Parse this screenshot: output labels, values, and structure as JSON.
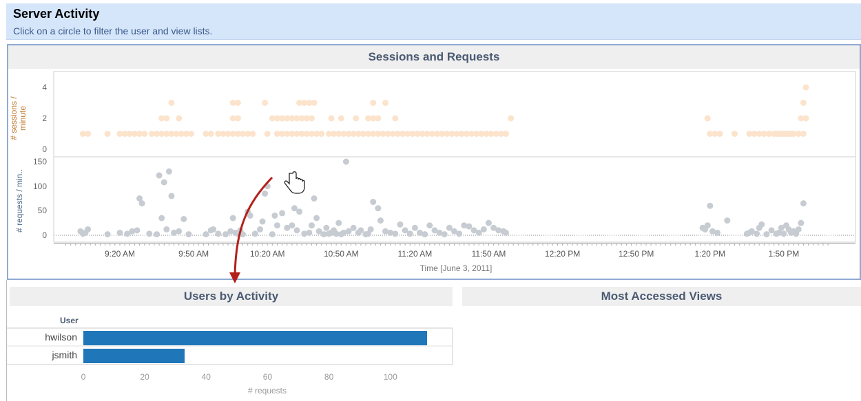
{
  "header": {
    "title": "Server Activity",
    "subtitle": "Click on a circle to filter the user and view lists."
  },
  "sessions_panel": {
    "title": "Sessions and Requests",
    "sessions_ylabel_line1": "# sessions /",
    "sessions_ylabel_line2": "minute",
    "requests_ylabel": "# requests / min..",
    "x_axis_title": "Time [June 3, 2011]"
  },
  "users_panel": {
    "title": "Users by Activity",
    "column_header": "User",
    "x_axis_title": "# requests"
  },
  "views_panel": {
    "title": "Most Accessed Views"
  },
  "colors": {
    "header_bg": "#d5e6fb",
    "sessions_dots": "#fbe3cc",
    "requests_dots": "#c7ccd2",
    "bar": "#1f76b8",
    "selected_dot": "#1a6396",
    "arrow": "#b3201c",
    "sessions_label": "#c07a30",
    "requests_label": "#4d6a8a"
  },
  "chart_data": [
    {
      "type": "scatter",
      "name": "sessions",
      "ylabel": "# sessions / minute",
      "ylim": [
        0,
        4.5
      ],
      "yticks": [
        0,
        2,
        4
      ],
      "x": [
        "9:05",
        "9:07",
        "9:15",
        "9:20",
        "9:22",
        "9:24",
        "9:26",
        "9:28",
        "9:30",
        "9:33",
        "9:35",
        "9:37",
        "9:39",
        "9:41",
        "9:43",
        "9:45",
        "9:47",
        "9:49",
        "9:55",
        "9:57",
        "10:00",
        "10:02",
        "10:04",
        "10:06",
        "10:08",
        "10:10",
        "10:12",
        "10:14",
        "10:20",
        "10:24",
        "10:26",
        "10:28",
        "10:30",
        "10:32",
        "10:34",
        "10:36",
        "10:38",
        "10:40",
        "10:42",
        "10:45",
        "10:47",
        "10:49",
        "10:51",
        "10:53",
        "10:55",
        "10:57",
        "10:59",
        "11:01",
        "11:03",
        "11:05",
        "11:07",
        "11:09",
        "11:11",
        "11:13",
        "11:15",
        "11:17",
        "11:19",
        "11:21",
        "11:23",
        "11:25",
        "11:27",
        "11:29",
        "11:31",
        "11:33",
        "11:35",
        "11:37",
        "11:39",
        "11:41",
        "11:43",
        "11:45",
        "11:47",
        "11:49",
        "11:51",
        "11:53",
        "11:55",
        "11:57",
        "1:20",
        "1:22",
        "1:24",
        "1:30",
        "1:36",
        "1:38",
        "1:40",
        "1:42",
        "1:44",
        "1:46",
        "1:48",
        "1:50",
        "1:52",
        "1:54",
        "1:56",
        "1:58",
        "1:42",
        "1:47",
        "1:49",
        "1:51",
        "1:53",
        "10:06",
        "10:08",
        "10:28",
        "10:30",
        "9:37",
        "9:39",
        "9:44",
        "10:22",
        "10:24",
        "10:26",
        "10:28",
        "10:30",
        "10:32",
        "10:34",
        "10:36",
        "10:38",
        "10:46",
        "10:50",
        "10:56",
        "11:01",
        "11:03",
        "11:05",
        "11:12",
        "11:59",
        "1:19",
        "1:57",
        "1:59",
        "9:41",
        "10:06",
        "10:08",
        "10:19",
        "10:33",
        "10:35",
        "10:37",
        "10:39",
        "11:03",
        "11:08",
        "1:58",
        "1:59"
      ],
      "y": [
        1,
        1,
        1,
        1,
        1,
        1,
        1,
        1,
        1,
        1,
        1,
        1,
        1,
        1,
        1,
        1,
        1,
        1,
        1,
        1,
        1,
        1,
        1,
        1,
        1,
        1,
        1,
        1,
        1,
        1,
        1,
        1,
        1,
        1,
        1,
        1,
        1,
        1,
        1,
        1,
        1,
        1,
        1,
        1,
        1,
        1,
        1,
        1,
        1,
        1,
        1,
        1,
        1,
        1,
        1,
        1,
        1,
        1,
        1,
        1,
        1,
        1,
        1,
        1,
        1,
        1,
        1,
        1,
        1,
        1,
        1,
        1,
        1,
        1,
        1,
        1,
        1,
        1,
        1,
        1,
        1,
        1,
        1,
        1,
        1,
        1,
        1,
        1,
        1,
        1,
        1,
        1,
        1,
        1,
        1,
        1,
        1,
        2,
        2,
        2,
        2,
        2,
        2,
        2,
        2,
        2,
        2,
        2,
        2,
        2,
        2,
        2,
        2,
        2,
        2,
        2,
        2,
        2,
        2,
        2,
        2,
        2,
        2,
        2,
        3,
        3,
        3,
        3,
        3,
        3,
        3,
        3,
        3,
        3,
        3,
        4
      ]
    },
    {
      "type": "scatter",
      "name": "requests",
      "ylabel": "# requests / min..",
      "xlabel": "Time [June 3, 2011]",
      "ylim": [
        -5,
        160
      ],
      "yticks": [
        0,
        50,
        100,
        150
      ],
      "xticks": [
        "9:20 AM",
        "9:50 AM",
        "10:20 AM",
        "10:50 AM",
        "11:20 AM",
        "11:50 AM",
        "12:20 PM",
        "12:50 PM",
        "1:20 PM",
        "1:50 PM"
      ],
      "x": [
        "9:04",
        "9:05",
        "9:06",
        "9:07",
        "9:15",
        "9:20",
        "9:23",
        "9:25",
        "9:27",
        "9:28",
        "9:29",
        "9:32",
        "9:35",
        "9:36",
        "9:37",
        "9:38",
        "9:39",
        "9:40",
        "9:41",
        "9:42",
        "9:44",
        "9:46",
        "9:48",
        "9:55",
        "9:57",
        "9:58",
        "10:00",
        "10:03",
        "10:05",
        "10:06",
        "10:07",
        "10:08",
        "10:09",
        "10:10",
        "10:12",
        "10:13",
        "10:15",
        "10:17",
        "10:18",
        "10:19",
        "10:20",
        "10:22",
        "10:24",
        "10:26",
        "10:28",
        "10:30",
        "10:31",
        "10:32",
        "10:33",
        "10:35",
        "10:37",
        "10:38",
        "10:39",
        "10:40",
        "10:41",
        "10:43",
        "10:44",
        "10:45",
        "10:46",
        "10:47",
        "10:48",
        "10:49",
        "10:50",
        "10:51",
        "10:52",
        "10:53",
        "10:55",
        "10:57",
        "10:58",
        "11:00",
        "11:01",
        "11:02",
        "11:03",
        "11:05",
        "11:06",
        "11:08",
        "11:10",
        "11:12",
        "11:14",
        "11:16",
        "11:18",
        "11:20",
        "11:22",
        "11:24",
        "11:26",
        "11:28",
        "11:30",
        "11:32",
        "11:34",
        "11:36",
        "11:38",
        "11:40",
        "11:42",
        "11:44",
        "11:46",
        "11:48",
        "11:50",
        "11:52",
        "11:54",
        "11:56",
        "11:57",
        "1:17",
        "1:18",
        "1:19",
        "1:20",
        "1:21",
        "1:23",
        "1:27",
        "1:35",
        "1:36",
        "1:37",
        "1:39",
        "1:40",
        "1:41",
        "1:43",
        "1:45",
        "1:47",
        "1:48",
        "1:49",
        "1:50",
        "1:51",
        "1:52",
        "1:53",
        "1:54",
        "1:55",
        "1:56",
        "1:57",
        "1:58",
        "10:23"
      ],
      "y": [
        8,
        3,
        5,
        12,
        2,
        5,
        3,
        8,
        10,
        75,
        65,
        3,
        2,
        122,
        35,
        108,
        12,
        130,
        80,
        5,
        8,
        33,
        2,
        2,
        10,
        12,
        3,
        2,
        8,
        35,
        5,
        3,
        10,
        2,
        48,
        40,
        3,
        12,
        28,
        85,
        100,
        2,
        20,
        45,
        15,
        20,
        55,
        10,
        48,
        3,
        5,
        20,
        75,
        35,
        8,
        2,
        15,
        3,
        5,
        10,
        3,
        25,
        2,
        5,
        150,
        8,
        15,
        5,
        10,
        2,
        3,
        12,
        68,
        55,
        30,
        8,
        5,
        3,
        22,
        10,
        3,
        15,
        5,
        2,
        20,
        10,
        5,
        2,
        15,
        8,
        3,
        20,
        18,
        10,
        5,
        12,
        25,
        15,
        10,
        8,
        5,
        15,
        12,
        20,
        60,
        8,
        5,
        30,
        3,
        5,
        8,
        3,
        15,
        22,
        2,
        10,
        3,
        5,
        15,
        3,
        20,
        12,
        5,
        8,
        3,
        12,
        25,
        65,
        40,
        140
      ]
    },
    {
      "type": "bar",
      "name": "Users by Activity",
      "categories": [
        "hwilson",
        "jsmith"
      ],
      "values": [
        112,
        33
      ],
      "xlabel": "# requests",
      "xticks": [
        0,
        20,
        40,
        60,
        80,
        100
      ],
      "xlim": [
        0,
        118
      ]
    }
  ]
}
